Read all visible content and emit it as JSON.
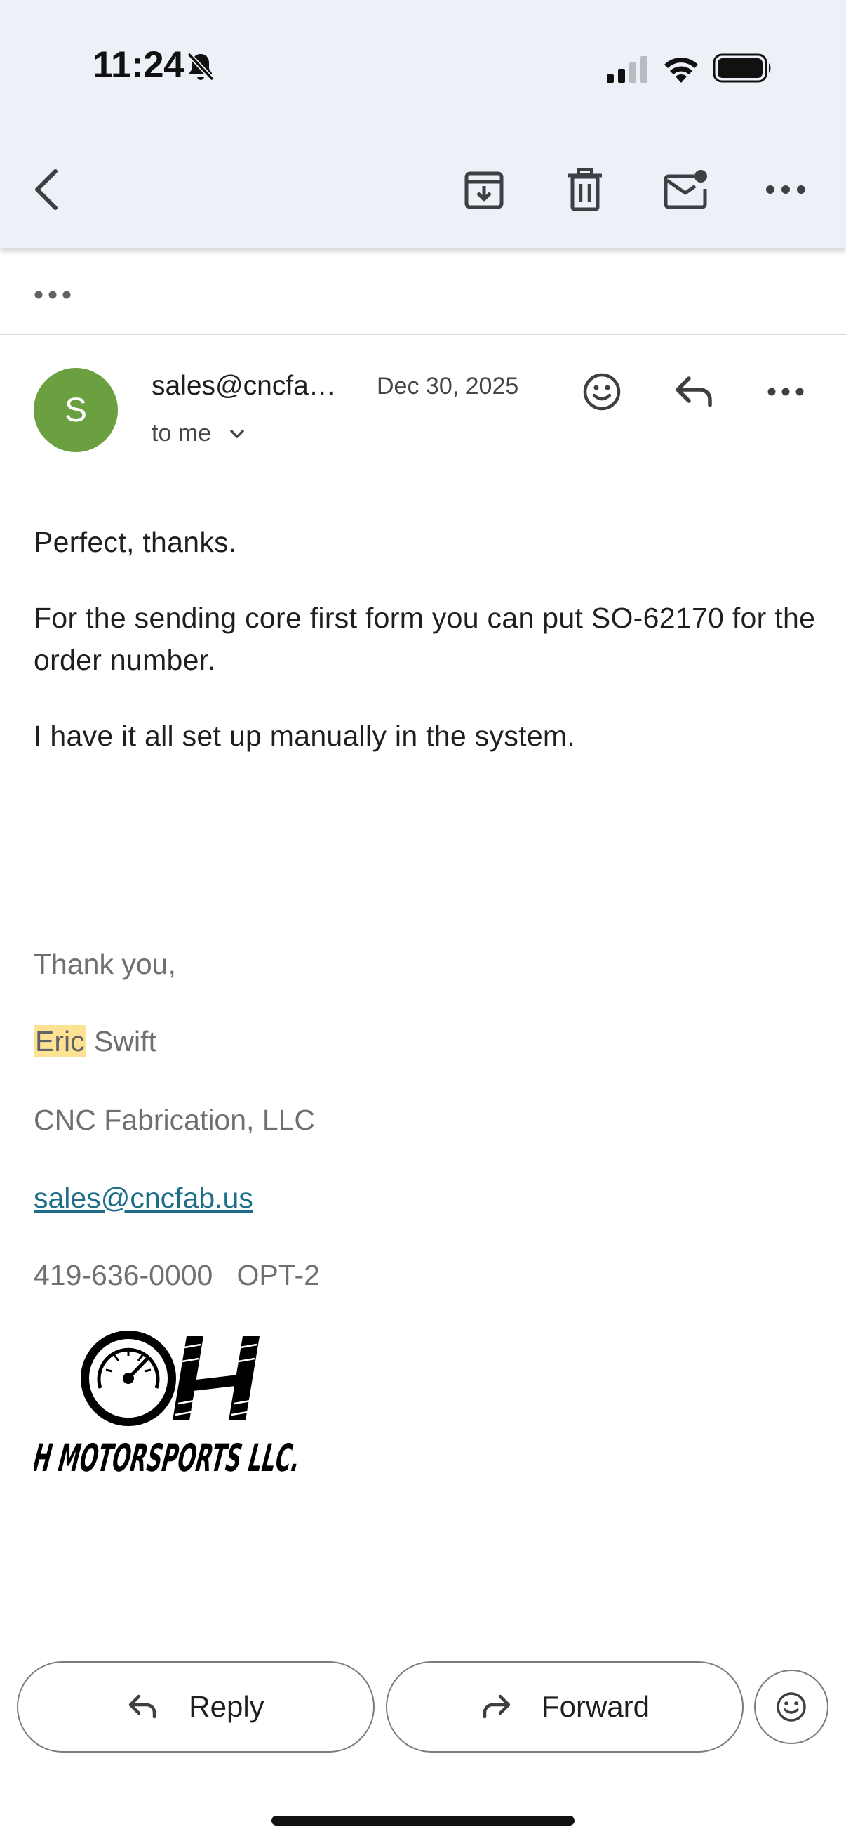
{
  "status_bar": {
    "time": "11:24"
  },
  "toolbar": {
    "back": "back-icon",
    "archive": "archive-icon",
    "delete": "trash-icon",
    "mark_unread": "mark-unread-icon",
    "more": "more-horizontal-icon"
  },
  "thread": {
    "collapsed_indicator": "more-horizontal-icon"
  },
  "message": {
    "avatar_letter": "S",
    "avatar_color": "#6aa03f",
    "sender": "sales@cncfa…",
    "date": "Dec 30, 2025",
    "recipient": "to me",
    "body": [
      "Perfect, thanks.",
      "For the sending core first form you can put SO-62170 for the order number.",
      "I have it all set up manually in the system."
    ],
    "signature": {
      "closing": "Thank you,",
      "first_name": "Eric",
      "last_name": " Swift",
      "company": "CNC Fabrication, LLC",
      "email": "sales@cncfab.us",
      "phone": "419-636-0000   OPT-2",
      "logo_text": "OH MOTORSPORTS LLC."
    }
  },
  "actions": {
    "reply": "Reply",
    "forward": "Forward"
  },
  "colors": {
    "header_bg": "#edf1f7",
    "link": "#1e6e8a",
    "highlight": "#fde293"
  }
}
